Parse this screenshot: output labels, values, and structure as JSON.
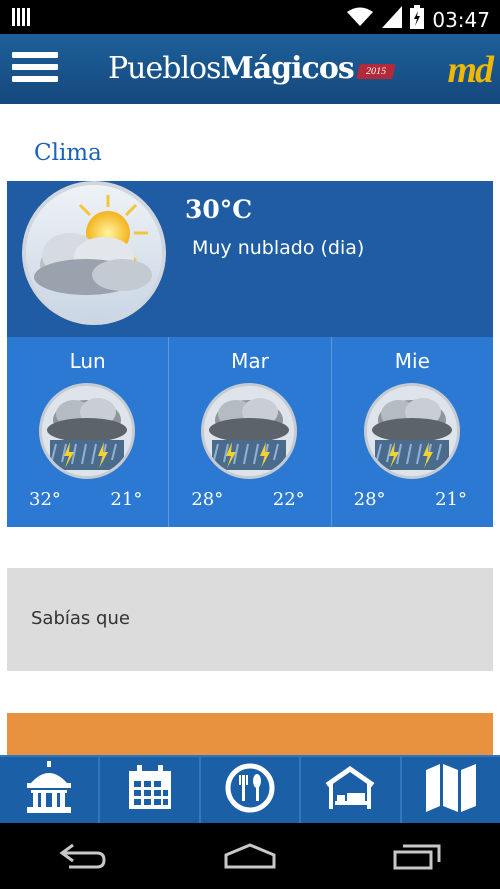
{
  "status_bar": {
    "time": "03:47",
    "icons": [
      "signal-bars-icon",
      "wifi-icon",
      "cell-signal-icon",
      "battery-icon"
    ]
  },
  "header": {
    "brand_light": "Pueblos ",
    "brand_bold": "Mágicos",
    "brand_year": "2015",
    "logo": "md",
    "menu_icon": "hamburger-menu-icon"
  },
  "weather": {
    "section_title": "Clima",
    "current": {
      "temperature": "30°C",
      "description": "Muy nublado (dia)",
      "icon": "cloudy-sun-icon"
    },
    "forecast": [
      {
        "day": "Lun",
        "high": "32°",
        "low": "21°",
        "icon": "thunderstorm-icon"
      },
      {
        "day": "Mar",
        "high": "28°",
        "low": "22°",
        "icon": "thunderstorm-icon"
      },
      {
        "day": "Mie",
        "high": "28°",
        "low": "21°",
        "icon": "thunderstorm-icon"
      }
    ]
  },
  "did_you_know": {
    "title": "Sabías que"
  },
  "tabbar": {
    "tabs": [
      {
        "name": "attractions",
        "icon": "kiosk-icon"
      },
      {
        "name": "events",
        "icon": "calendar-icon"
      },
      {
        "name": "restaurants",
        "icon": "plate-cutlery-icon"
      },
      {
        "name": "lodging",
        "icon": "house-bed-icon"
      },
      {
        "name": "map",
        "icon": "map-icon"
      }
    ]
  },
  "nav_bar": {
    "buttons": [
      "back-icon",
      "home-icon",
      "recents-icon"
    ]
  },
  "colors": {
    "header_blue": "#1e5f9a",
    "current_weather_blue": "#1f5ca3",
    "forecast_blue": "#2b79d2",
    "title_blue": "#1b62b8",
    "orange": "#e8923f",
    "gray_card": "#dcdcdc",
    "logo_yellow": "#f0b800",
    "year_badge_red": "#b22a3a"
  }
}
